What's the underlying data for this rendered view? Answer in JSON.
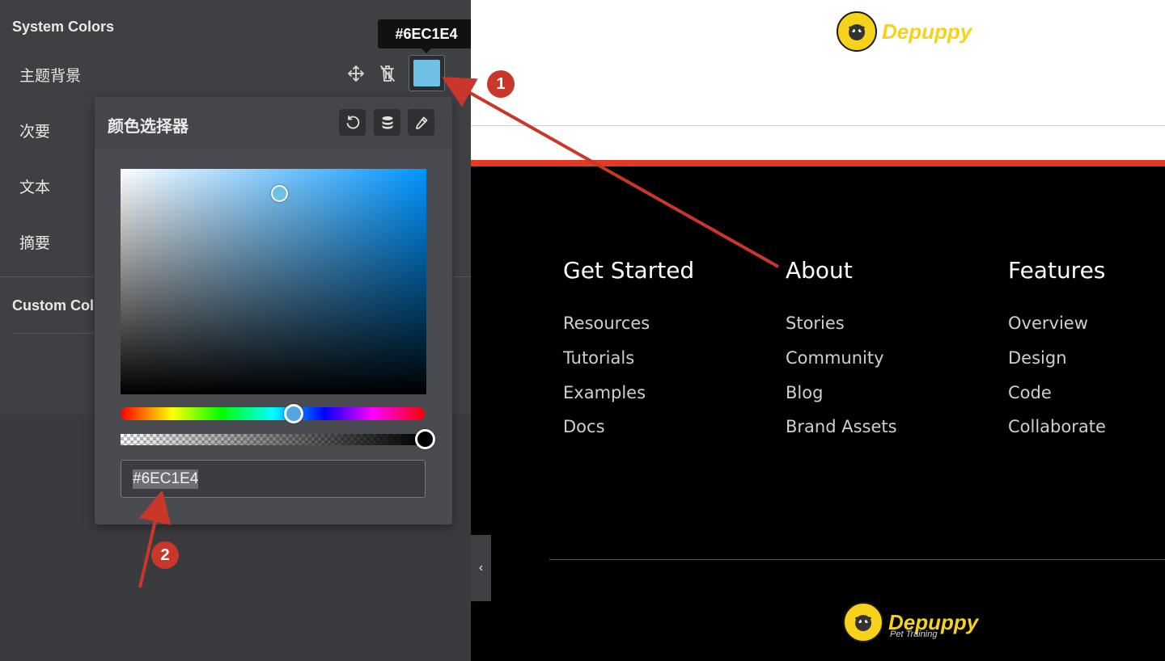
{
  "sidebar": {
    "system_colors_title": "System Colors",
    "custom_colors_title": "Custom Col",
    "rows": [
      {
        "label": "主题背景"
      },
      {
        "label": "次要"
      },
      {
        "label": "文本"
      },
      {
        "label": "摘要"
      }
    ],
    "tooltip": "#6EC1E4",
    "icons": {
      "move": "move-icon",
      "delete": "trash-icon"
    }
  },
  "picker": {
    "title": "颜色选择器",
    "hex_value": "#6EC1E4",
    "current_color": "#6EC1E4",
    "tools": [
      "reset-icon",
      "global-colors-icon",
      "eyedropper-icon"
    ],
    "hue": 0.57,
    "saturation": 0.52,
    "brightness": 0.89,
    "alpha": 1
  },
  "preview": {
    "logo_word": "Depuppy",
    "logo_sub": "Pet Training",
    "accent_color": "#E23B24",
    "columns": [
      {
        "heading": "Get Started",
        "links": [
          "Resources",
          "Tutorials",
          "Examples",
          "Docs"
        ]
      },
      {
        "heading": "About",
        "links": [
          "Stories",
          "Community",
          "Blog",
          "Brand Assets"
        ]
      },
      {
        "heading": "Features",
        "links": [
          "Overview",
          "Design",
          "Code",
          "Collaborate"
        ]
      }
    ]
  },
  "annotations": {
    "badge_1": "1",
    "badge_2": "2",
    "arrow_color": "#C8372A"
  }
}
